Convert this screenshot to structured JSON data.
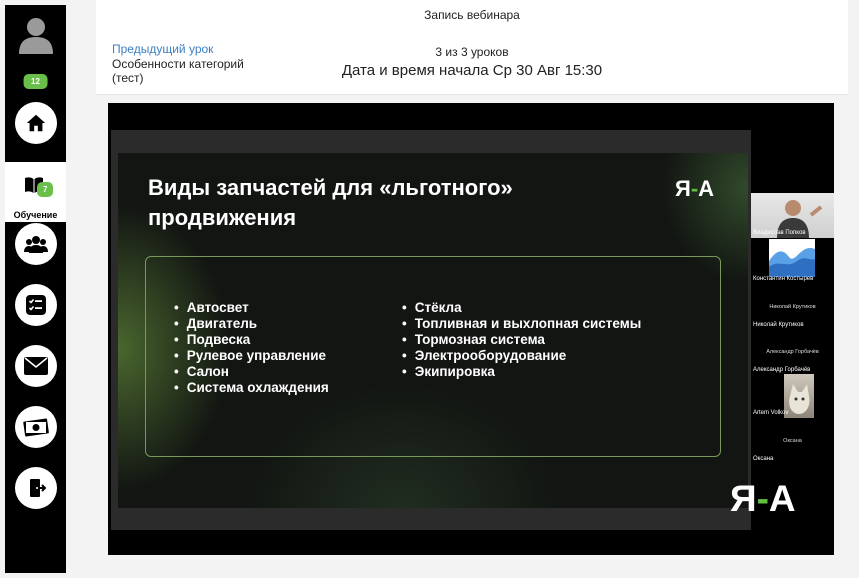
{
  "sidebar": {
    "profile_badge": "12",
    "learning_badge": "7",
    "learning_label": "Обучение"
  },
  "header": {
    "webinar_title": "Запись вебинара",
    "prev_lesson_link": "Предыдущий урок",
    "prev_lesson_name": "Особенности категорий (тест)",
    "lesson_counter": "3 из 3 уроков",
    "start_datetime": "Дата и время начала Ср 30 Авг 15:30"
  },
  "slide": {
    "title": "Виды запчастей для «льготного» продвижения",
    "logo_left": "Я",
    "logo_dash": "-",
    "logo_right": "А",
    "left_items": [
      "Автосвет",
      "Двигатель",
      "Подвеска",
      "Рулевое управление",
      "Салон",
      "Система охлаждения"
    ],
    "right_items": [
      "Стёкла",
      "Топливная и выхлопная системы",
      "Тормозная система",
      "Электрооборудование",
      "Экипировка"
    ]
  },
  "participants": {
    "p1": "Владислав Попков",
    "p2": "Константин Костырев",
    "p3_center": "Николай Крутиков",
    "p3": "Николай Крутиков",
    "p4_center": "Александр Горбачёв",
    "p4": "Александр Горбачёв",
    "p5": "Artem Volkov",
    "p6_center": "Оксана",
    "p6": "Оксана"
  },
  "colors": {
    "accent_green": "#6abf4b",
    "link_blue": "#3b7fc4",
    "slide_border": "#789a58"
  }
}
